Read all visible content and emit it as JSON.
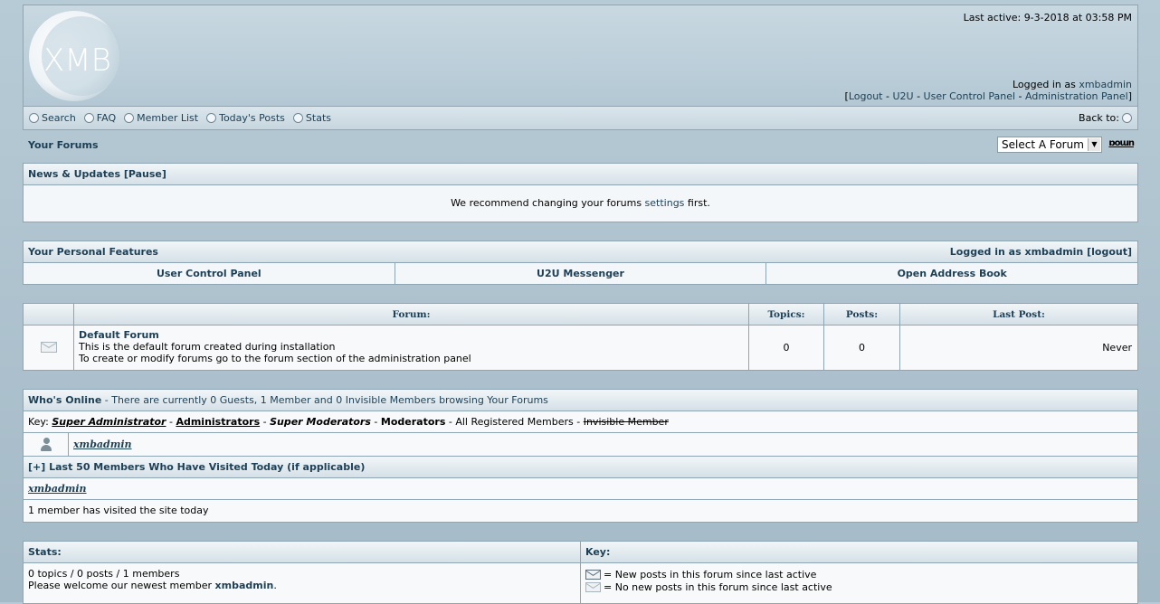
{
  "header": {
    "logo_text": "XMB",
    "last_active": "Last active: 9-3-2018 at 03:58 PM",
    "logged_in_prefix": "Logged in as ",
    "username": "xmbadmin",
    "links": [
      "Logout",
      "U2U",
      "User Control Panel",
      "Administration Panel"
    ]
  },
  "nav": {
    "items": [
      "Search",
      "FAQ",
      "Member List",
      "Today's Posts",
      "Stats"
    ],
    "back_to": "Back to:"
  },
  "forum_bar": {
    "title": "Your Forums",
    "select_value": "Select A Forum",
    "go_label": "ɒoɯn"
  },
  "news": {
    "title": "News & Updates [Pause]",
    "text_prefix": "We recommend changing your forums ",
    "link": "settings",
    "text_suffix": " first."
  },
  "features": {
    "title": "Your Personal Features",
    "logged_in": "Logged in as xmbadmin [logout]",
    "items": [
      "User Control Panel",
      "U2U Messenger",
      "Open Address Book"
    ]
  },
  "forums_table": {
    "headers": [
      "",
      "Forum:",
      "Topics:",
      "Posts:",
      "Last Post:"
    ],
    "rows": [
      {
        "name": "Default Forum",
        "desc1": "This is the default forum created during installation",
        "desc2": "To create or modify forums go to the forum section of the administration panel",
        "topics": "0",
        "posts": "0",
        "last_post": "Never"
      }
    ]
  },
  "online": {
    "title": "Who's Online",
    "sub": " - There are currently 0 Guests, 1 Member and 0 Invisible Members browsing Your Forums",
    "key_prefix": "Key: ",
    "key_super_admin": "Super Administrator",
    "key_admins": "Administrators",
    "key_super_mods": "Super Moderators",
    "key_mods": "Moderators",
    "key_registered": "All Registered Members",
    "key_invisible": "Invisible Member",
    "online_user": "xmbadmin",
    "visited_title": "[+] Last 50 Members Who Have Visited Today (if applicable)",
    "visited_user": "xmbadmin",
    "visited_count": "1 member has visited the site today"
  },
  "stats": {
    "title": "Stats:",
    "line1": "0 topics / 0 posts / 1 members",
    "line2_prefix": "Please welcome our newest member ",
    "line2_user": "xmbadmin",
    "line2_suffix": "."
  },
  "key": {
    "title": "Key:",
    "new_posts": "= New posts in this forum since last active",
    "no_new_posts": "= No new posts in this forum since last active"
  }
}
